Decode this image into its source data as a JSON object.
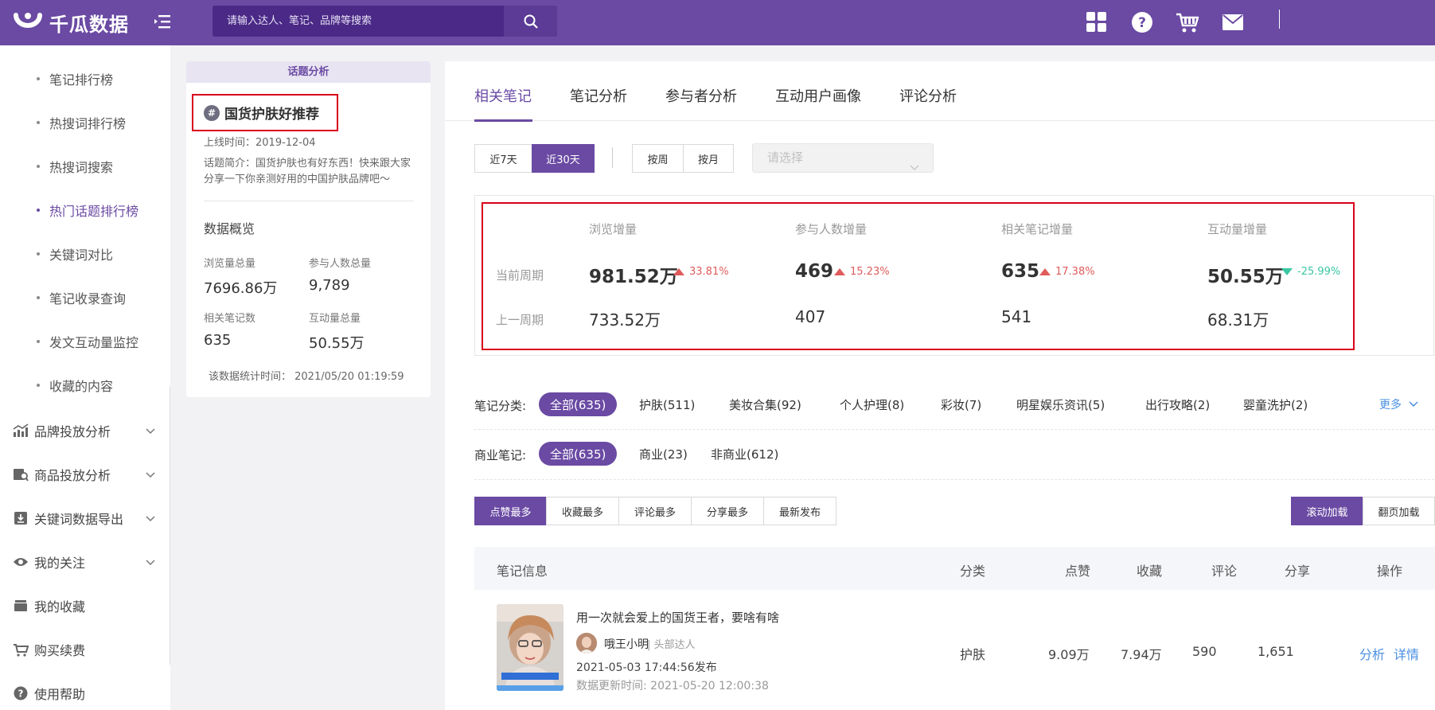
{
  "header": {
    "brand": "千瓜数据",
    "search_placeholder": "请输入达人、笔记、品牌等搜索"
  },
  "sidebar": {
    "sub_items": [
      "笔记排行榜",
      "热搜词排行榜",
      "热搜词搜索",
      "热门话题排行榜",
      "关键词对比",
      "笔记收录查询",
      "发文互动量监控",
      "收藏的内容"
    ],
    "active_sub_item": "热门话题排行榜",
    "nav_items": [
      "品牌投放分析",
      "商品投放分析",
      "关键词数据导出",
      "我的关注",
      "我的收藏",
      "购买续费",
      "使用帮助"
    ]
  },
  "topic_card": {
    "header": "话题分析",
    "title": "国货护肤好推荐",
    "online_time": "上线时间：2019-12-04",
    "description": "话题简介：国货护肤也有好东西！快来跟大家分享一下你亲测好用的中国护肤品牌吧～",
    "overview_title": "数据概览",
    "stats": [
      {
        "label": "浏览量总量",
        "value": "7696.86万"
      },
      {
        "label": "参与人数总量",
        "value": "9,789"
      },
      {
        "label": "相关笔记数",
        "value": "635"
      },
      {
        "label": "互动量总量",
        "value": "50.55万"
      }
    ],
    "stat_time": "该数据统计时间：  2021/05/20 01:19:59"
  },
  "main": {
    "tabs": [
      "相关笔记",
      "笔记分析",
      "参与者分析",
      "互动用户画像",
      "评论分析"
    ],
    "active_tab": "相关笔记",
    "range_buttons": [
      "近7天",
      "近30天"
    ],
    "active_range": "近30天",
    "period_buttons": [
      "按周",
      "按月"
    ],
    "select_placeholder": "请选择",
    "stats_table": {
      "row_labels": [
        "当前周期",
        "上一周期"
      ],
      "columns": [
        {
          "header": "浏览增量",
          "current": "981.52万",
          "change": "33.81%",
          "direction": "up",
          "previous": "733.52万"
        },
        {
          "header": "参与人数增量",
          "current": "469",
          "change": "15.23%",
          "direction": "up",
          "previous": "407"
        },
        {
          "header": "相关笔记增量",
          "current": "635",
          "change": "17.38%",
          "direction": "up",
          "previous": "541"
        },
        {
          "header": "互动量增量",
          "current": "50.55万",
          "change": "-25.99%",
          "direction": "down",
          "previous": "68.31万"
        }
      ]
    },
    "category_label": "笔记分类:",
    "categories": [
      "全部(635)",
      "护肤(511)",
      "美妆合集(92)",
      "个人护理(8)",
      "彩妆(7)",
      "明星娱乐资讯(5)",
      "出行攻略(2)",
      "婴童洗护(2)"
    ],
    "more_label": "更多",
    "commercial_label": "商业笔记:",
    "commercial_filters": [
      "全部(635)",
      "商业(23)",
      "非商业(612)"
    ],
    "sort_buttons": [
      "点赞最多",
      "收藏最多",
      "评论最多",
      "分享最多",
      "最新发布"
    ],
    "load_buttons": [
      "滚动加载",
      "翻页加载"
    ],
    "table_headers": [
      "笔记信息",
      "分类",
      "点赞",
      "收藏",
      "评论",
      "分享",
      "操作"
    ],
    "rows": [
      {
        "title": "用一次就会爱上的国货王者，要啥有啥",
        "author": "哦王小明",
        "author_tag": "| 头部达人",
        "published": "2021-05-03 17:44:56发布",
        "updated": "数据更新时间:    2021-05-20 12:00:38",
        "category": "护肤",
        "likes": "9.09万",
        "favorites": "7.94万",
        "comments": "590",
        "shares": "1,651",
        "action_analyze": "分析",
        "action_detail": "详情"
      }
    ]
  },
  "colors": {
    "brand": "#6a4aa3",
    "up": "#e05b5b",
    "down": "#3bc7a3",
    "link": "#4a90e2",
    "highlight_border": "#d9001b"
  }
}
